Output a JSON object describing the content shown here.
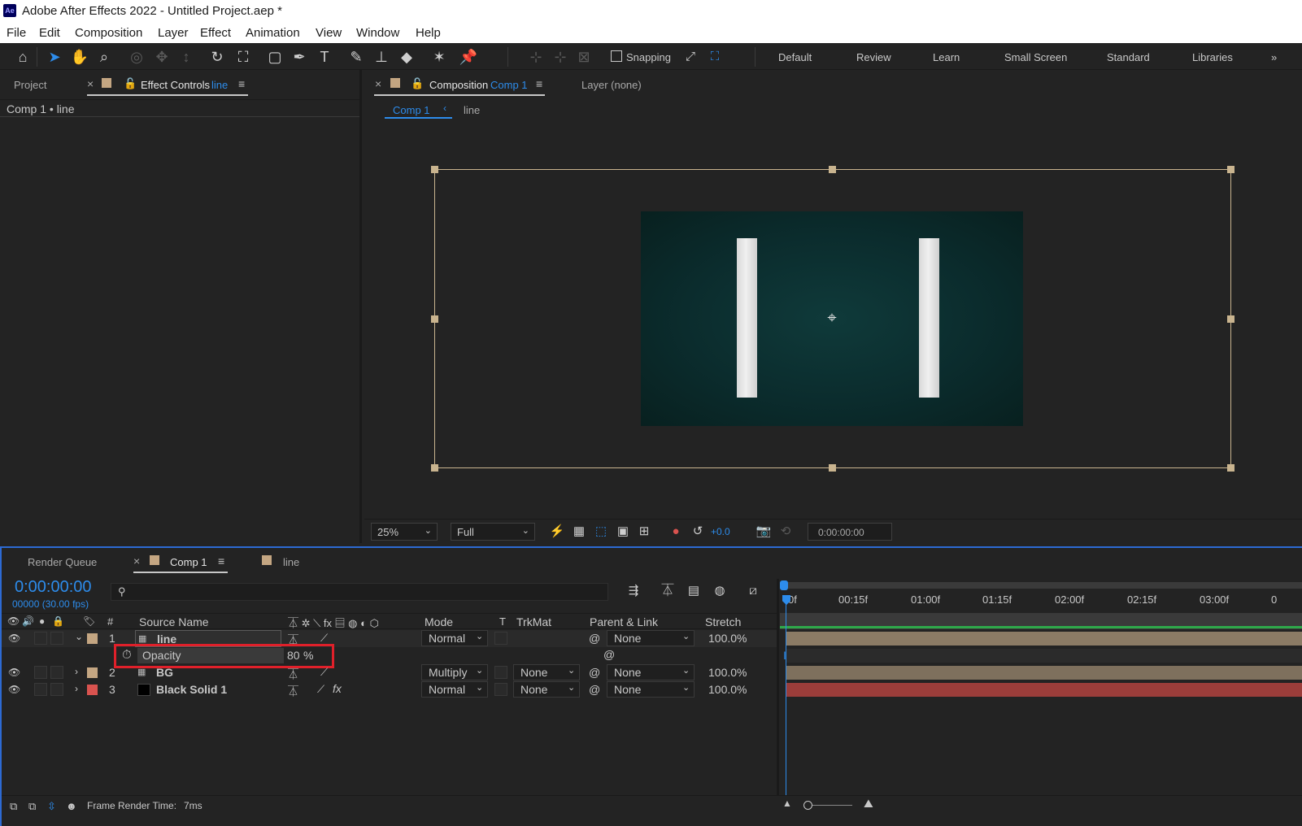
{
  "window": {
    "title": "Adobe After Effects 2022 - Untitled Project.aep *",
    "logo": "Ae"
  },
  "menu": [
    "File",
    "Edit",
    "Composition",
    "Layer",
    "Effect",
    "Animation",
    "View",
    "Window",
    "Help"
  ],
  "toolbar": {
    "snapping_label": "Snapping",
    "workspaces": [
      "Default",
      "Review",
      "Learn",
      "Small Screen",
      "Standard",
      "Libraries"
    ]
  },
  "left_panel": {
    "tab_project": "Project",
    "tab_effect_controls": "Effect Controls",
    "tab_effect_controls_layer": "line",
    "header": "Comp 1 • line"
  },
  "comp_panel": {
    "tab_composition": "Composition",
    "tab_composition_name": "Comp 1",
    "tab_layer": "Layer (none)",
    "breadcrumb_comp": "Comp 1",
    "breadcrumb_layer": "line",
    "zoom": "25%",
    "resolution": "Full",
    "exposure": "+0.0",
    "timecode": "0:00:00:00"
  },
  "timeline": {
    "tab_render_queue": "Render Queue",
    "tab_comp": "Comp 1",
    "tab_line": "line",
    "current_time": "0:00:00:00",
    "frame_info": "00000 (30.00 fps)",
    "search_placeholder": "",
    "columns": {
      "num": "#",
      "source_name": "Source Name",
      "mode": "Mode",
      "t": "T",
      "trkmat": "TrkMat",
      "parent": "Parent & Link",
      "stretch": "Stretch"
    },
    "ruler": [
      "0f",
      "00:15f",
      "01:00f",
      "01:15f",
      "02:00f",
      "02:15f",
      "03:00f",
      "0"
    ],
    "layers": [
      {
        "num": "1",
        "name": "line",
        "mode": "Normal",
        "trkmat": "",
        "parent": "None",
        "stretch": "100.0%",
        "label_color": "#c4a682"
      },
      {
        "num": "2",
        "name": "BG",
        "mode": "Multiply",
        "trkmat": "None",
        "parent": "None",
        "stretch": "100.0%",
        "label_color": "#c4a682"
      },
      {
        "num": "3",
        "name": "Black Solid 1",
        "mode": "Normal",
        "trkmat": "None",
        "parent": "None",
        "stretch": "100.0%",
        "label_color": "#d9534f"
      }
    ],
    "property": {
      "name": "Opacity",
      "value": "80",
      "unit": "%"
    },
    "status_label": "Frame Render Time:",
    "status_value": "7ms"
  },
  "colors": {
    "accent": "#2d8ceb",
    "highlight_box": "#e0202a",
    "layer_bar_tan": "#8b7b65",
    "layer_bar_red": "#9b3d3a"
  }
}
